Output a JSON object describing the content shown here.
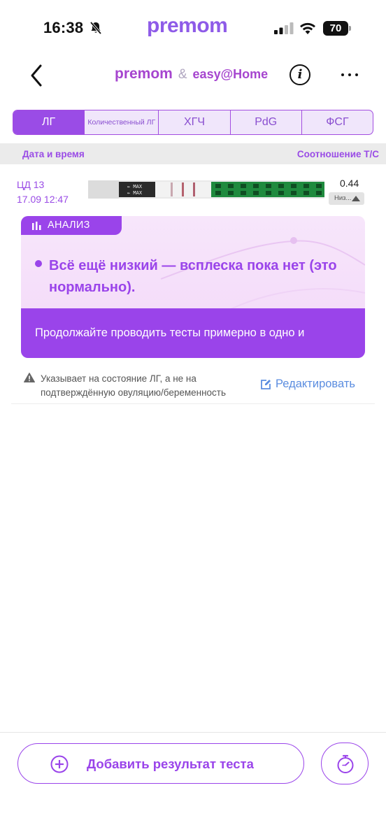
{
  "status_bar": {
    "time": "16:38",
    "logo": "premom",
    "battery": "70",
    "icons": [
      "bell-slash-icon",
      "cellular-signal-icon",
      "wifi-icon",
      "battery-icon"
    ]
  },
  "nav": {
    "brand_premom": "premom",
    "brand_amp": "&",
    "brand_easy": "easy@Home",
    "info_label": "i",
    "icons": [
      "chevron-left-icon",
      "info-icon",
      "more-dots-icon"
    ]
  },
  "tabs": [
    {
      "label": "ЛГ",
      "active": true
    },
    {
      "label": "Количественный ЛГ",
      "active": false
    },
    {
      "label": "ХГЧ",
      "active": false
    },
    {
      "label": "PdG",
      "active": false
    },
    {
      "label": "ФСГ",
      "active": false
    }
  ],
  "table_header": {
    "left": "Дата и время",
    "right": "Соотношение Т/С"
  },
  "result": {
    "cycle_day": "ЦД 13",
    "datetime": "17.09 12:47",
    "ratio": "0.44",
    "level": "Низ..."
  },
  "analysis": {
    "tag": "АНАЛИЗ",
    "title": "Всё ещё низкий — всплеска пока нет (это нормально).",
    "footer": "Продолжайте проводить тесты примерно в одно и"
  },
  "note": {
    "text": "Указывает на состояние ЛГ, а не на подтверждённую овуляцию/беременность",
    "edit_label": "Редактировать"
  },
  "bottom": {
    "add_label": "Добавить результат теста"
  },
  "colors": {
    "accent": "#9a44ea",
    "tab_bg": "#f0e6fb",
    "link": "#5b8de0"
  }
}
